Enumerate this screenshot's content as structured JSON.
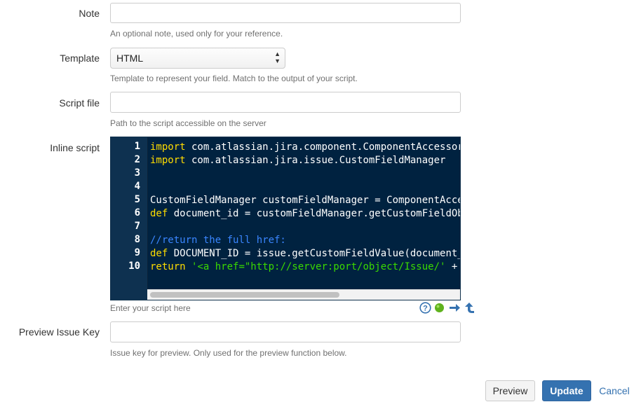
{
  "note": {
    "label": "Note",
    "value": "",
    "help": "An optional note, used only for your reference."
  },
  "template": {
    "label": "Template",
    "selected": "HTML",
    "help": "Template to represent your field. Match to the output of your script."
  },
  "script_file": {
    "label": "Script file",
    "value": "",
    "help": "Path to the script accessible on the server"
  },
  "inline_script": {
    "label": "Inline script",
    "line_numbers": [
      "1",
      "2",
      "3",
      "4",
      "5",
      "6",
      "7",
      "8",
      "9",
      "10"
    ],
    "lines": [
      [
        {
          "t": "kw",
          "v": "import"
        },
        {
          "t": "tx",
          "v": " com.atlassian.jira.component.ComponentAccessor"
        }
      ],
      [
        {
          "t": "kw",
          "v": "import"
        },
        {
          "t": "tx",
          "v": " com.atlassian.jira.issue.CustomFieldManager"
        }
      ],
      [],
      [],
      [
        {
          "t": "tx",
          "v": "CustomFieldManager customFieldManager = ComponentAccessor.getCustomFieldManager()"
        }
      ],
      [
        {
          "t": "kw",
          "v": "def"
        },
        {
          "t": "tx",
          "v": " document_id = customFieldManager.getCustomFieldObjectByName(\"Document ID\")"
        }
      ],
      [],
      [
        {
          "t": "cm",
          "v": "//return the full href:"
        }
      ],
      [
        {
          "t": "kw",
          "v": "def"
        },
        {
          "t": "tx",
          "v": " DOCUMENT_ID = issue.getCustomFieldValue(document_id)"
        }
      ],
      [
        {
          "t": "kw",
          "v": "return"
        },
        {
          "t": "tx",
          "v": " "
        },
        {
          "t": "st",
          "v": "'<a href=\"http://server:port/object/Issue/'"
        },
        {
          "t": "tx",
          "v": " + DOCUMENT_ID"
        }
      ]
    ],
    "help": "Enter your script here",
    "tools": {
      "help_icon": "question-circle-icon",
      "status_icon": "green-dot-icon",
      "expand_icon": "arrow-right-icon",
      "collapse_icon": "arrow-up-left-icon"
    }
  },
  "preview_issue_key": {
    "label": "Preview Issue Key",
    "value": "",
    "help": "Issue key for preview. Only used for the preview function below."
  },
  "buttons": {
    "preview": "Preview",
    "update": "Update",
    "cancel": "Cancel"
  },
  "colors": {
    "editor_bg": "#002240",
    "keyword": "#ffdd00",
    "comment": "#3a86ff",
    "string": "#3ad900",
    "primary": "#3572b0"
  }
}
